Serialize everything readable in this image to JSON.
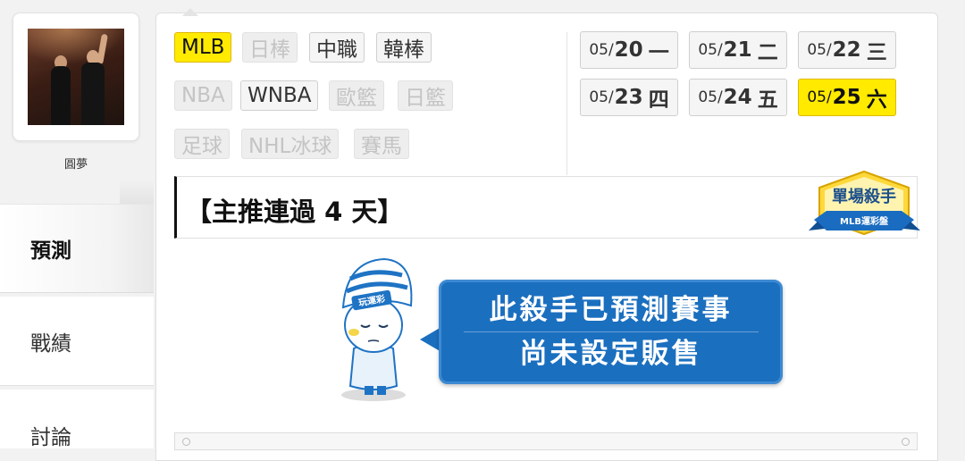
{
  "sidebar": {
    "user_name": "圓夢",
    "tabs": [
      {
        "label": "預測",
        "active": true
      },
      {
        "label": "戰績",
        "active": false
      },
      {
        "label": "討論",
        "active": false
      }
    ]
  },
  "leagues": [
    {
      "label": "MLB",
      "state": "active"
    },
    {
      "label": "日棒",
      "state": "disabled"
    },
    {
      "label": "中職",
      "state": "enabled"
    },
    {
      "label": "韓棒",
      "state": "enabled"
    },
    {
      "label": "NBA",
      "state": "disabled"
    },
    {
      "label": "WNBA",
      "state": "enabled"
    },
    {
      "label": "歐籃",
      "state": "disabled"
    },
    {
      "label": "日籃",
      "state": "disabled"
    },
    {
      "label": "足球",
      "state": "disabled"
    },
    {
      "label": "NHL冰球",
      "state": "disabled"
    },
    {
      "label": "賽馬",
      "state": "disabled"
    }
  ],
  "dates": [
    {
      "md": "05/",
      "day": "20",
      "weekday": "一",
      "active": false
    },
    {
      "md": "05/",
      "day": "21",
      "weekday": "二",
      "active": false
    },
    {
      "md": "05/",
      "day": "22",
      "weekday": "三",
      "active": false
    },
    {
      "md": "05/",
      "day": "23",
      "weekday": "四",
      "active": false
    },
    {
      "md": "05/",
      "day": "24",
      "weekday": "五",
      "active": false
    },
    {
      "md": "05/",
      "day": "25",
      "weekday": "六",
      "active": true
    }
  ],
  "banner": {
    "title": "【主推連過 4 天】",
    "badge_title": "單場殺手",
    "badge_sub": "MLB運彩盤"
  },
  "notice": {
    "mascot_cap_text": "玩運彩",
    "line1": "此殺手已預測賽事",
    "line2": "尚未設定販售"
  },
  "colors": {
    "active_yellow": "#ffea00",
    "notice_blue": "#1b6fbf",
    "badge_blue": "#1a6cc0"
  }
}
